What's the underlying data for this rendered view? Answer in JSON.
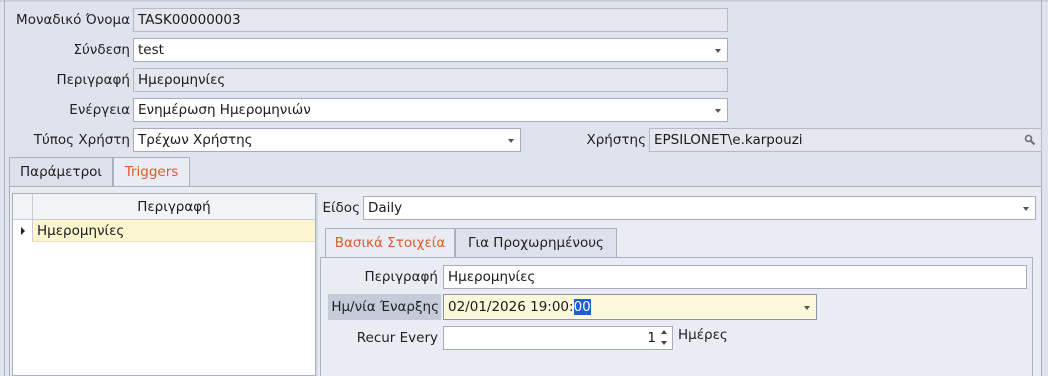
{
  "form": {
    "unique_name_label": "Μοναδικό Όνομα",
    "unique_name_value": "TASK00000003",
    "connection_label": "Σύνδεση",
    "connection_value": "test",
    "description_label": "Περιγραφή",
    "description_value": "Ημερομηνίες",
    "action_label": "Ενέργεια",
    "action_value": "Ενημέρωση Ημερομηνιών",
    "user_type_label": "Τύπος Χρήστη",
    "user_type_value": "Τρέχων Χρήστης",
    "user_label": "Χρήστης",
    "user_value": "EPSILONET\\e.karpouzi"
  },
  "tabs": [
    {
      "label": "Παράμετροι",
      "active": false
    },
    {
      "label": "Triggers",
      "active": true
    }
  ],
  "grid": {
    "column_header": "Περιγραφή",
    "rows": [
      {
        "description": "Ημερομηνίες",
        "selected": true
      }
    ]
  },
  "trigger": {
    "kind_label": "Είδος",
    "kind_value": "Daily",
    "subtabs": [
      {
        "label": "Βασικά Στοιχεία",
        "active": true
      },
      {
        "label": "Για Προχωρημένους",
        "active": false
      }
    ],
    "description_label": "Περιγραφή",
    "description_value": "Ημερομηνίες",
    "start_date_label": "Ημ/νία Έναρξης",
    "start_date_value_main": "02/01/2026 19:00:",
    "start_date_value_selected": "00",
    "recur_label": "Recur Every",
    "recur_value": "1",
    "recur_unit": "Ημέρες"
  },
  "colors": {
    "background": "#dfe3ee",
    "active_tab_text": "#e05a2a",
    "grid_selected_row": "#fbf5d0",
    "focused_field": "#fbf8dc",
    "focused_label": "#c5cbd8",
    "text_selection": "#1c5fd1"
  }
}
